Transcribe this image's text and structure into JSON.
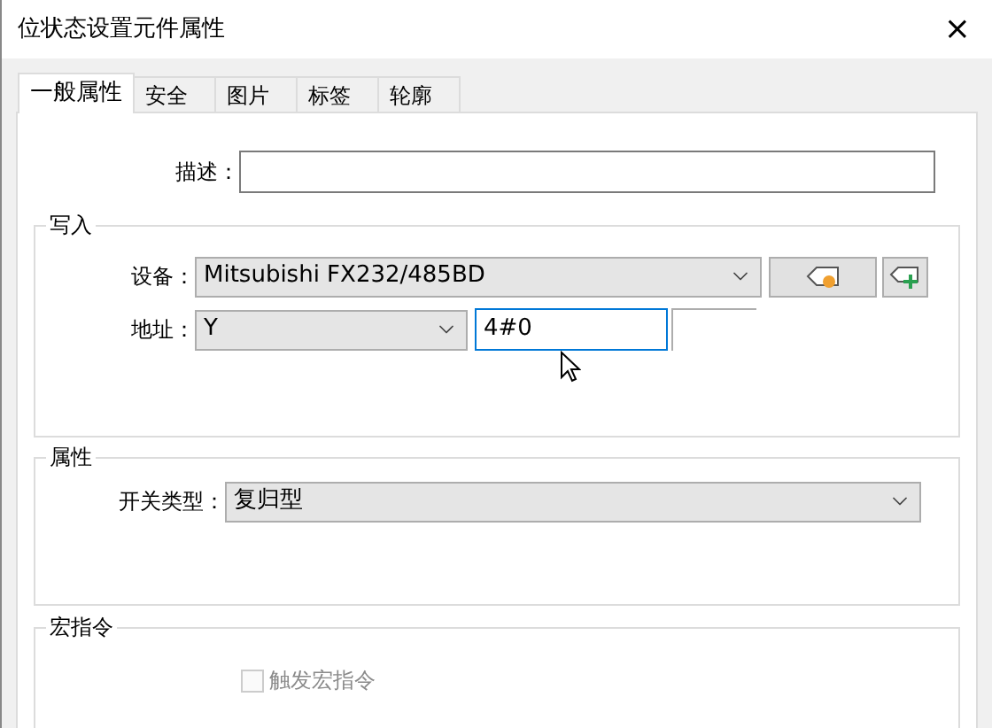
{
  "window": {
    "title": "位状态设置元件属性",
    "close": "×"
  },
  "tabs": [
    {
      "label": "一般属性",
      "selected": true
    },
    {
      "label": "安全",
      "selected": false
    },
    {
      "label": "图片",
      "selected": false
    },
    {
      "label": "标签",
      "selected": false
    },
    {
      "label": "轮廓",
      "selected": false
    }
  ],
  "description": {
    "label": "描述："
  },
  "write": {
    "title": "写入",
    "device_label": "设备：",
    "device": "Mitsubishi FX232/485BD",
    "address_label": "地址：",
    "address_type": "Y",
    "address": "4#0"
  },
  "properties": {
    "title": "属性",
    "switch_type_label": "开关类型：",
    "switch_type": "复归型"
  },
  "macro": {
    "title": "宏指令",
    "trigger": {
      "label": "触发宏指令",
      "checked": false,
      "disabled": true
    }
  }
}
